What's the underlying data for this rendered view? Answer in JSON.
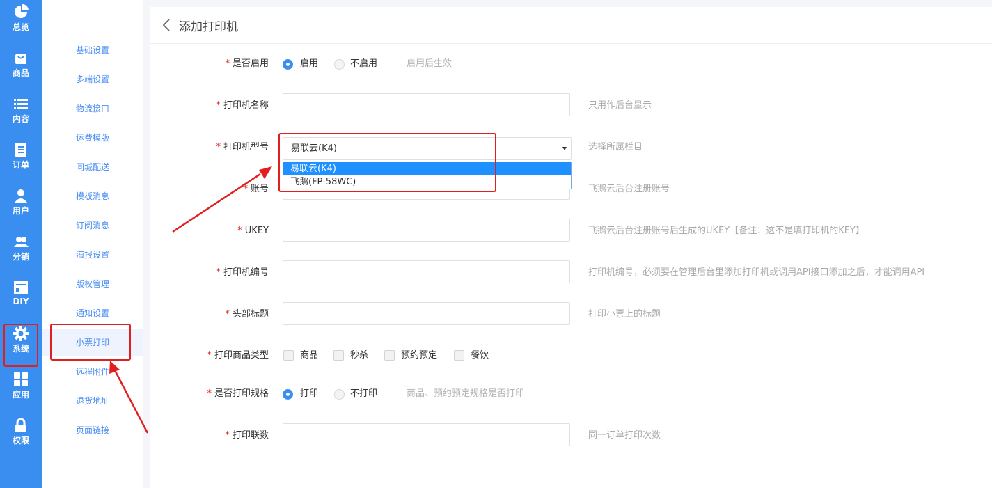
{
  "nav": {
    "rail": [
      {
        "label": "总览",
        "icon": "pie-chart-icon"
      },
      {
        "label": "商品",
        "icon": "shopping-bag-icon"
      },
      {
        "label": "内容",
        "icon": "list-icon"
      },
      {
        "label": "订单",
        "icon": "order-icon"
      },
      {
        "label": "用户",
        "icon": "user-icon"
      },
      {
        "label": "分销",
        "icon": "group-icon"
      },
      {
        "label": "DIY",
        "icon": "layout-icon"
      },
      {
        "label": "系统",
        "icon": "gear-icon",
        "active": true
      },
      {
        "label": "应用",
        "icon": "apps-grid-icon"
      },
      {
        "label": "权限",
        "icon": "lock-icon"
      }
    ],
    "submenu": [
      "基础设置",
      "多端设置",
      "物流接口",
      "运费模版",
      "同城配送",
      "模板消息",
      "订阅消息",
      "海报设置",
      "版权管理",
      "通知设置",
      "小票打印",
      "远程附件",
      "退货地址",
      "页面链接"
    ],
    "submenu_active": "小票打印"
  },
  "page": {
    "title": "添加打印机"
  },
  "form": {
    "enable": {
      "label": "是否启用",
      "options": [
        "启用",
        "不启用"
      ],
      "selected": "启用",
      "hint": "启用后生效"
    },
    "name": {
      "label": "打印机名称",
      "value": "",
      "hint": "只用作后台显示"
    },
    "model": {
      "label": "打印机型号",
      "value": "易联云(K4)",
      "options": [
        "易联云(K4)",
        "飞鹅(FP-58WC)"
      ],
      "highlighted": "易联云(K4)",
      "hint": "选择所属栏目"
    },
    "account": {
      "label": "账号",
      "value": "",
      "hint": "飞鹅云后台注册账号"
    },
    "ukey": {
      "label": "UKEY",
      "value": "",
      "hint": "飞鹅云后台注册账号后生成的UKEY【备注：这不是填打印机的KEY】"
    },
    "printer_no": {
      "label": "打印机编号",
      "value": "",
      "hint": "打印机编号，必须要在管理后台里添加打印机或调用API接口添加之后，才能调用API"
    },
    "header_title": {
      "label": "头部标题",
      "value": "",
      "hint": "打印小票上的标题"
    },
    "goods_type": {
      "label": "打印商品类型",
      "options": [
        "商品",
        "秒杀",
        "预约预定",
        "餐饮"
      ],
      "checked": []
    },
    "print_spec": {
      "label": "是否打印规格",
      "options": [
        "打印",
        "不打印"
      ],
      "selected": "打印",
      "hint": "商品、预约预定规格是否打印"
    },
    "copies": {
      "label": "打印联数",
      "value": "",
      "hint": "同一订单打印次数"
    },
    "required_mark": "*"
  },
  "colors": {
    "rail_bg": "#3a8ef0",
    "accent": "#3a8ef0",
    "annotation": "#e02020",
    "dropdown_highlight": "#1e90ff"
  }
}
